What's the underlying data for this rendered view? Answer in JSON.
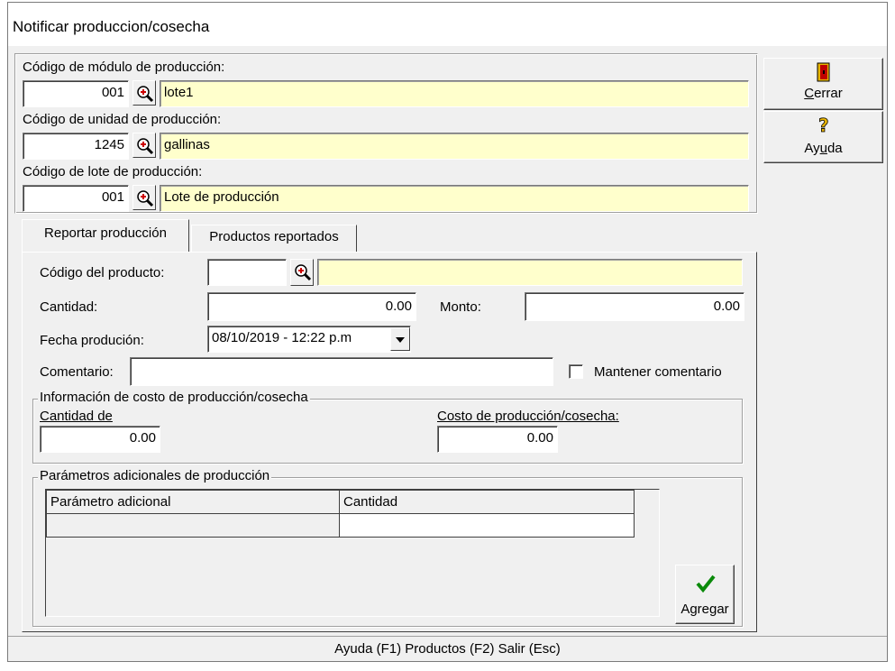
{
  "window": {
    "title": "Notificar produccion/cosecha"
  },
  "header": {
    "modulo": {
      "label": "Código de módulo de producción:",
      "code": "001",
      "name": "lote1"
    },
    "unidad": {
      "label": "Código de unidad de producción:",
      "code": "1245",
      "name": "gallinas"
    },
    "lote": {
      "label": "Código de lote de producción:",
      "code": "001",
      "name": "Lote de producción"
    }
  },
  "side_buttons": {
    "cerrar": "Cerrar",
    "ayuda": "Ayuda"
  },
  "tabs": [
    {
      "label": "Reportar producción",
      "active": true
    },
    {
      "label": "Productos reportados",
      "active": false
    }
  ],
  "form": {
    "producto_label": "Código del producto:",
    "producto_value": "",
    "producto_name": "",
    "cantidad_label": "Cantidad:",
    "cantidad_value": "0.00",
    "monto_label": "Monto:",
    "monto_value": "0.00",
    "fecha_label": "Fecha produción:",
    "fecha_value": "08/10/2019 - 12:22 p.m",
    "comentario_label": "Comentario:",
    "comentario_value": "",
    "mantener_label": "Mantener comentario",
    "mantener_checked": false
  },
  "costo_group": {
    "legend": "Información de costo de producción/cosecha",
    "cantidad_label": "Cantidad de",
    "cantidad_value": "0.00",
    "costo_label": "Costo de producción/cosecha:",
    "costo_value": "0.00"
  },
  "params_group": {
    "legend": "Parámetros adicionales de producción",
    "columns": [
      "Parámetro adicional",
      "Cantidad"
    ],
    "rows": [
      [
        "",
        ""
      ]
    ]
  },
  "agregar_button": "Agregar",
  "statusbar": "Ayuda (F1)   Productos (F2)   Salir (Esc)"
}
